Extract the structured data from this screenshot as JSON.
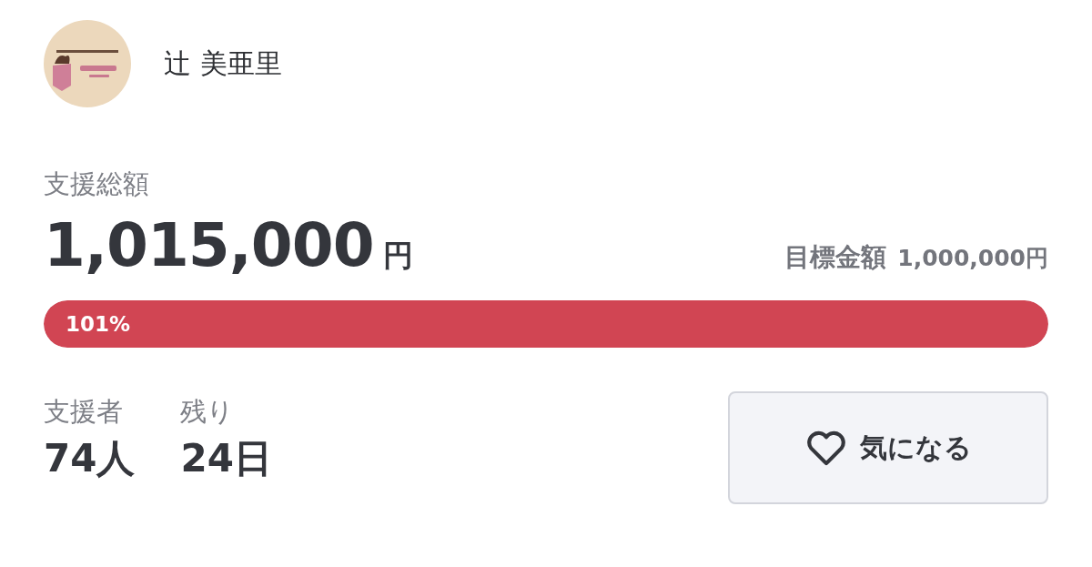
{
  "owner": {
    "name": "辻 美亜里"
  },
  "funding": {
    "label": "支援総額",
    "amount": "1,015,000",
    "unit": "円",
    "goal_label": "目標金額",
    "goal_value": "1,000,000円",
    "level": 1,
    "percent": "101%"
  },
  "stats": [
    {
      "label": "支援者",
      "value": "74人"
    },
    {
      "label": "残り",
      "value": "24日"
    }
  ],
  "favorite_button": {
    "label": "気になる"
  }
}
